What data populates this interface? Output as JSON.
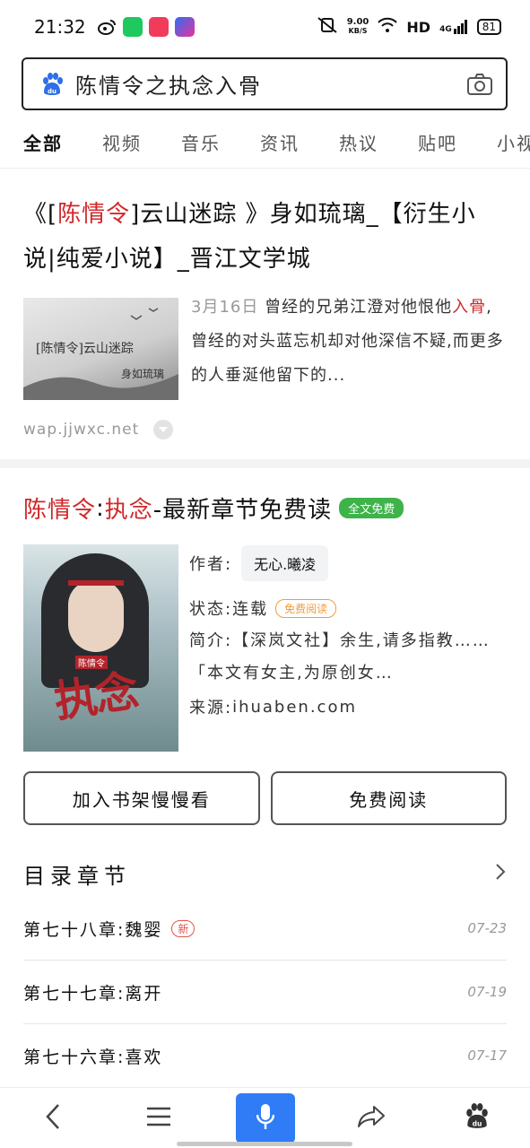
{
  "status_bar": {
    "time": "21:32",
    "net_speed": "9.00",
    "net_unit": "KB/S",
    "hd": "HD",
    "signal": "4G",
    "battery": "81"
  },
  "search": {
    "query": "陈情令之执念入骨"
  },
  "tabs": [
    "全部",
    "视频",
    "音乐",
    "资讯",
    "热议",
    "贴吧",
    "小视"
  ],
  "result1": {
    "title_pre": "《[",
    "title_hl": "陈情令",
    "title_post": "]云山迷踪 》身如琉璃_【衍生小说|纯爱小说】_晋江文学城",
    "thumb_text1": "[陈情令]云山迷踪",
    "thumb_text2": "身如琉璃",
    "date": "3月16日",
    "snippet_pre": " 曾经的兄弟江澄对他恨他",
    "snippet_hl": "入骨",
    "snippet_post": ",曾经的对头蓝忘机却对他深信不疑,而更多的人垂涎他留下的...",
    "source": "wap.jjwxc.net"
  },
  "result2": {
    "title_hl1": "陈情令",
    "title_sep": ":",
    "title_hl2": "执念",
    "title_post": "-最新章节免费读",
    "badge": "全文免费",
    "cover_small": "陈情令",
    "cover_big": "执念",
    "author_label": "作者:",
    "author": "无心.曦凌",
    "status_label": "状态:",
    "status": "连载",
    "status_badge": "免费阅读",
    "intro_label": "简介:",
    "intro": "【深岚文社】余生,请多指教……「本文有女主,为原创女…",
    "source_label": "来源:",
    "source": "ihuaben.com",
    "btn_shelf": "加入书架慢慢看",
    "btn_read": "免费阅读",
    "toc_title": "目录章节",
    "chapters": [
      {
        "name": "第七十八章:魏婴",
        "date": "07-23",
        "badge": "新"
      },
      {
        "name": "第七十七章:离开",
        "date": "07-19",
        "badge": ""
      },
      {
        "name": "第七十六章:喜欢",
        "date": "07-17",
        "badge": ""
      }
    ]
  },
  "colors": {
    "accent": "#1a73e8",
    "highlight": "#d0282a",
    "voice": "#2f7cf6",
    "green_badge": "#3db349",
    "orange_badge": "#f29b38"
  }
}
